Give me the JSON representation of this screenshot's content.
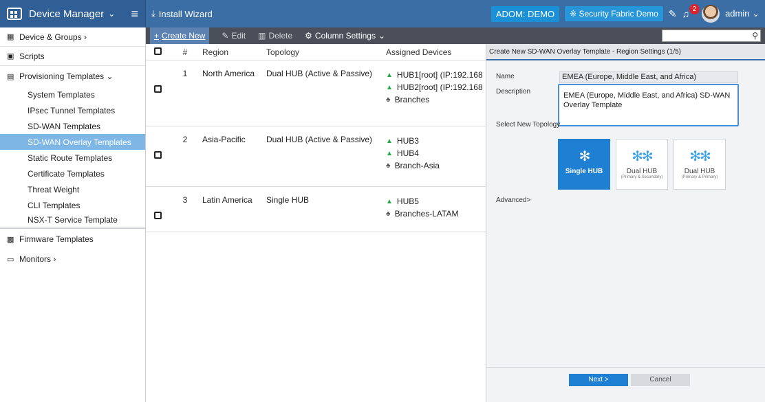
{
  "header": {
    "app_title": "Device Manager",
    "install_wizard": "Install Wizard",
    "adom": "ADOM: DEMO",
    "security_fabric": "Security Fabric Demo",
    "notification_count": "2",
    "user": "admin"
  },
  "sidebar": {
    "device_groups": "Device & Groups",
    "scripts": "Scripts",
    "provisioning": "Provisioning Templates",
    "sub_items": [
      "System Templates",
      "IPsec Tunnel Templates",
      "SD-WAN Templates",
      "SD-WAN Overlay Templates",
      "Static Route Templates",
      "Certificate Templates",
      "Threat Weight",
      "CLI Templates",
      "NSX-T Service Template"
    ],
    "firmware": "Firmware Templates",
    "monitors": "Monitors"
  },
  "toolbar": {
    "create_new": "Create New",
    "edit": "Edit",
    "delete": "Delete",
    "column_settings": "Column Settings"
  },
  "table": {
    "headers": [
      "#",
      "Region",
      "Topology",
      "Assigned Devices"
    ],
    "rows": [
      {
        "num": "1",
        "region": "North America",
        "topology": "Dual HUB (Active & Passive)",
        "devices": [
          "HUB1[root] (IP:192.168",
          "HUB2[root] (IP:192.168"
        ],
        "group": "Branches"
      },
      {
        "num": "2",
        "region": "Asia-Pacific",
        "topology": "Dual HUB (Active & Passive)",
        "devices": [
          "HUB3",
          "HUB4"
        ],
        "group": "Branch-Asia"
      },
      {
        "num": "3",
        "region": "Latin America",
        "topology": "Single HUB",
        "devices": [
          "HUB5"
        ],
        "group": "Branches-LATAM"
      }
    ]
  },
  "panel": {
    "title": "Create New SD-WAN Overlay Template - Region Settings (1/5)",
    "name_label": "Name",
    "name_value": "EMEA (Europe, Middle East, and Africa)",
    "description_label": "Description",
    "description_value": "EMEA (Europe, Middle East, and Africa) SD-WAN Overlay Template",
    "topology_label": "Select New Topology",
    "topologies": [
      {
        "label": "Single HUB",
        "sub": ""
      },
      {
        "label": "Dual HUB",
        "sub": "(Primary & Secondary)"
      },
      {
        "label": "Dual HUB",
        "sub": "(Primary & Primary)"
      }
    ],
    "advanced": "Advanced>",
    "next": "Next >",
    "cancel": "Cancel"
  }
}
